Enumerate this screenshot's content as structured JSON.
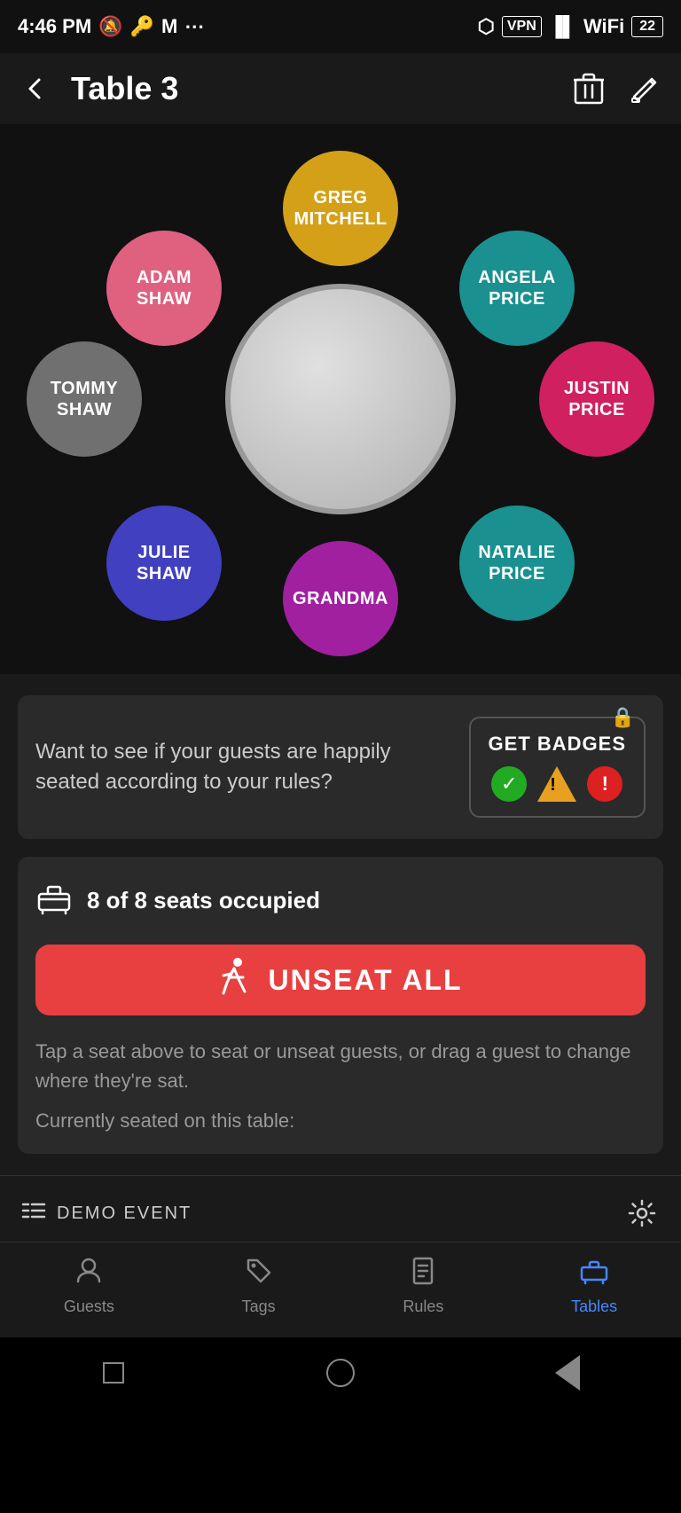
{
  "statusBar": {
    "time": "4:46 PM",
    "battery": "22"
  },
  "header": {
    "backLabel": "←",
    "title": "Table 3"
  },
  "seats": [
    {
      "id": "greg",
      "name": "GREG\nMITCHELL",
      "color": "#D4A017",
      "position": "top"
    },
    {
      "id": "adam",
      "name": "ADAM\nSHAW",
      "color": "#E06080",
      "position": "top-left"
    },
    {
      "id": "angela",
      "name": "ANGELA\nPRICE",
      "color": "#1A9090",
      "position": "top-right"
    },
    {
      "id": "tommy",
      "name": "TOMMY\nSHAW",
      "color": "#707070",
      "position": "left"
    },
    {
      "id": "justin",
      "name": "JUSTIN\nPRICE",
      "color": "#D02060",
      "position": "right"
    },
    {
      "id": "julie",
      "name": "JULIE\nSHAW",
      "color": "#4040C0",
      "position": "bottom-left"
    },
    {
      "id": "natalie",
      "name": "NATALIE\nPRICE",
      "color": "#1A9090",
      "position": "bottom-right"
    },
    {
      "id": "grandma",
      "name": "GRANDMA",
      "color": "#A020A0",
      "position": "bottom"
    }
  ],
  "badgesCard": {
    "text": "Want to see if your guests are happily seated according to your rules?",
    "buttonLabel": "GET BADGES"
  },
  "seatsOccupied": {
    "label": "8 of 8 seats occupied"
  },
  "unseatButton": {
    "label": "UNSEAT ALL"
  },
  "hintText": "Tap a seat above to seat or unseat guests, or drag a guest to change where they're sat.",
  "seatedText": "Currently seated on this table:",
  "eventBar": {
    "name": "DEMO EVENT"
  },
  "navTabs": [
    {
      "id": "guests",
      "label": "Guests",
      "active": false
    },
    {
      "id": "tags",
      "label": "Tags",
      "active": false
    },
    {
      "id": "rules",
      "label": "Rules",
      "active": false
    },
    {
      "id": "tables",
      "label": "Tables",
      "active": true
    }
  ]
}
